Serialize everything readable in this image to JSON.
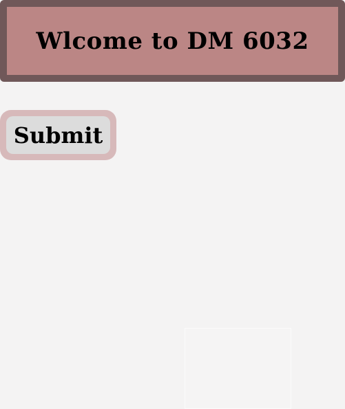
{
  "header": {
    "title": "Wlcome to DM 6032"
  },
  "form": {
    "submit_label": "Submit"
  },
  "colors": {
    "page_background": "#f4f3f3",
    "header_fill": "#bb8685",
    "header_border": "#705859",
    "button_outer": "#d7b9ba",
    "button_fill": "#dcdcdc",
    "text": "#000000"
  }
}
